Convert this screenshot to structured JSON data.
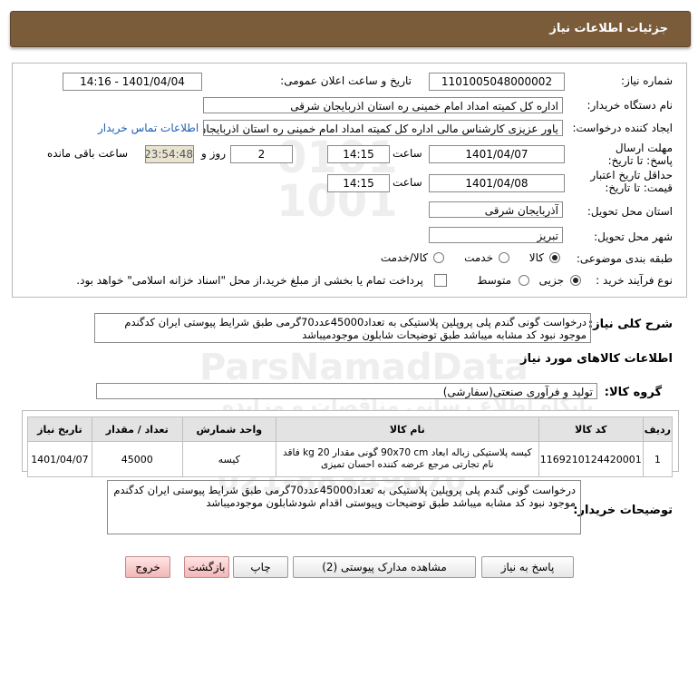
{
  "header": {
    "title": "جزئیات اطلاعات نیاز"
  },
  "form": {
    "need_number_label": "شماره نیاز:",
    "need_number": "1101005048000002",
    "announce_label": "تاریخ و ساعت اعلان عمومی:",
    "announce_value": "1401/04/04 - 14:16",
    "buyer_org_label": "نام دستگاه خریدار:",
    "buyer_org": "اداره کل کمیته امداد امام خمینی  ره  استان اذربایجان شرقی",
    "creator_label": "ایجاد کننده درخواست:",
    "creator": "یاور عزیزی کارشناس مالی اداره کل کمیته امداد امام خمینی  ره  استان اذربایجان شرقی",
    "contact_link": "اطلاعات تماس خریدار",
    "deadline_label": "مهلت ارسال پاسخ: تا تاریخ:",
    "deadline_date": "1401/04/07",
    "time_label": "ساعت",
    "deadline_time": "14:15",
    "days_value": "2",
    "days_label": "روز و",
    "remaining_time": "23:54:48",
    "remaining_label": "ساعت باقی مانده",
    "validity_label": "حداقل تاریخ اعتبار قیمت: تا تاریخ:",
    "validity_date": "1401/04/08",
    "validity_time": "14:15",
    "province_label": "استان محل تحویل:",
    "province": "آذربایجان شرقی",
    "city_label": "شهر محل تحویل:",
    "city": "تبریز",
    "category_label": "طبقه بندی موضوعی:",
    "category_options": [
      "کالا",
      "خدمت",
      "کالا/خدمت"
    ],
    "purchase_type_label": "نوع فرآیند خرید :",
    "purchase_options": [
      "جزیی",
      "متوسط"
    ],
    "payment_note": "پرداخت تمام یا بخشی از مبلغ خرید،از محل \"اسناد خزانه اسلامی\" خواهد بود."
  },
  "description": {
    "label": "شرح کلی نیاز:",
    "text": "درخواست گونی گندم پلی پروپلین پلاستیکی به تعداد45000عدد70گرمی طبق شرایط پیوستی ایران کدگندم موجود نبود کد مشابه میباشد طبق توضیحات  شابلون موجودمیباشد"
  },
  "goods": {
    "section_title": "اطلاعات کالاهای مورد نیاز",
    "group_label": "گروه کالا:",
    "group_value": "تولید و فرآوری صنعتی(سفارشی)",
    "columns": [
      "ردیف",
      "کد کالا",
      "نام کالا",
      "واحد شمارش",
      "تعداد / مقدار",
      "تاریخ نیاز"
    ],
    "rows": [
      {
        "row": "1",
        "code": "1169210124420001",
        "name": "کیسه پلاستیکی زباله ابعاد 90x70 cm گونی مقدار 20 kg فاقد نام تجارتی مرجع عرضه کننده احسان تمیزی",
        "unit": "کیسه",
        "qty": "45000",
        "date": "1401/04/07"
      }
    ]
  },
  "notes": {
    "label": "توضیحات خریدار:",
    "text": "درخواست گونی گندم پلی پروپلین پلاستیکی به تعداد45000عدد70گرمی طبق شرایط پیوستی ایران کدگندم موجود نبود کد مشابه میباشد طبق توضیحات وپیوستی اقدام شودشابلون موجودمیباشد"
  },
  "buttons": {
    "reply": "پاسخ به نیاز",
    "attachments": "مشاهده مدارک پیوستی (2)",
    "print": "چاپ",
    "back": "بازگشت",
    "exit": "خروج"
  },
  "watermark": {
    "brand": "ParsNamadData",
    "subtitle": "پایگاه اطلاع رسانی مناقصات و مزایده",
    "phone": "021-88349670"
  },
  "colors": {
    "header": "#7a5c3b",
    "timer_bg": "#e9e4d0",
    "link": "#1a5fb4",
    "danger_btn": "#f2b7b7"
  }
}
